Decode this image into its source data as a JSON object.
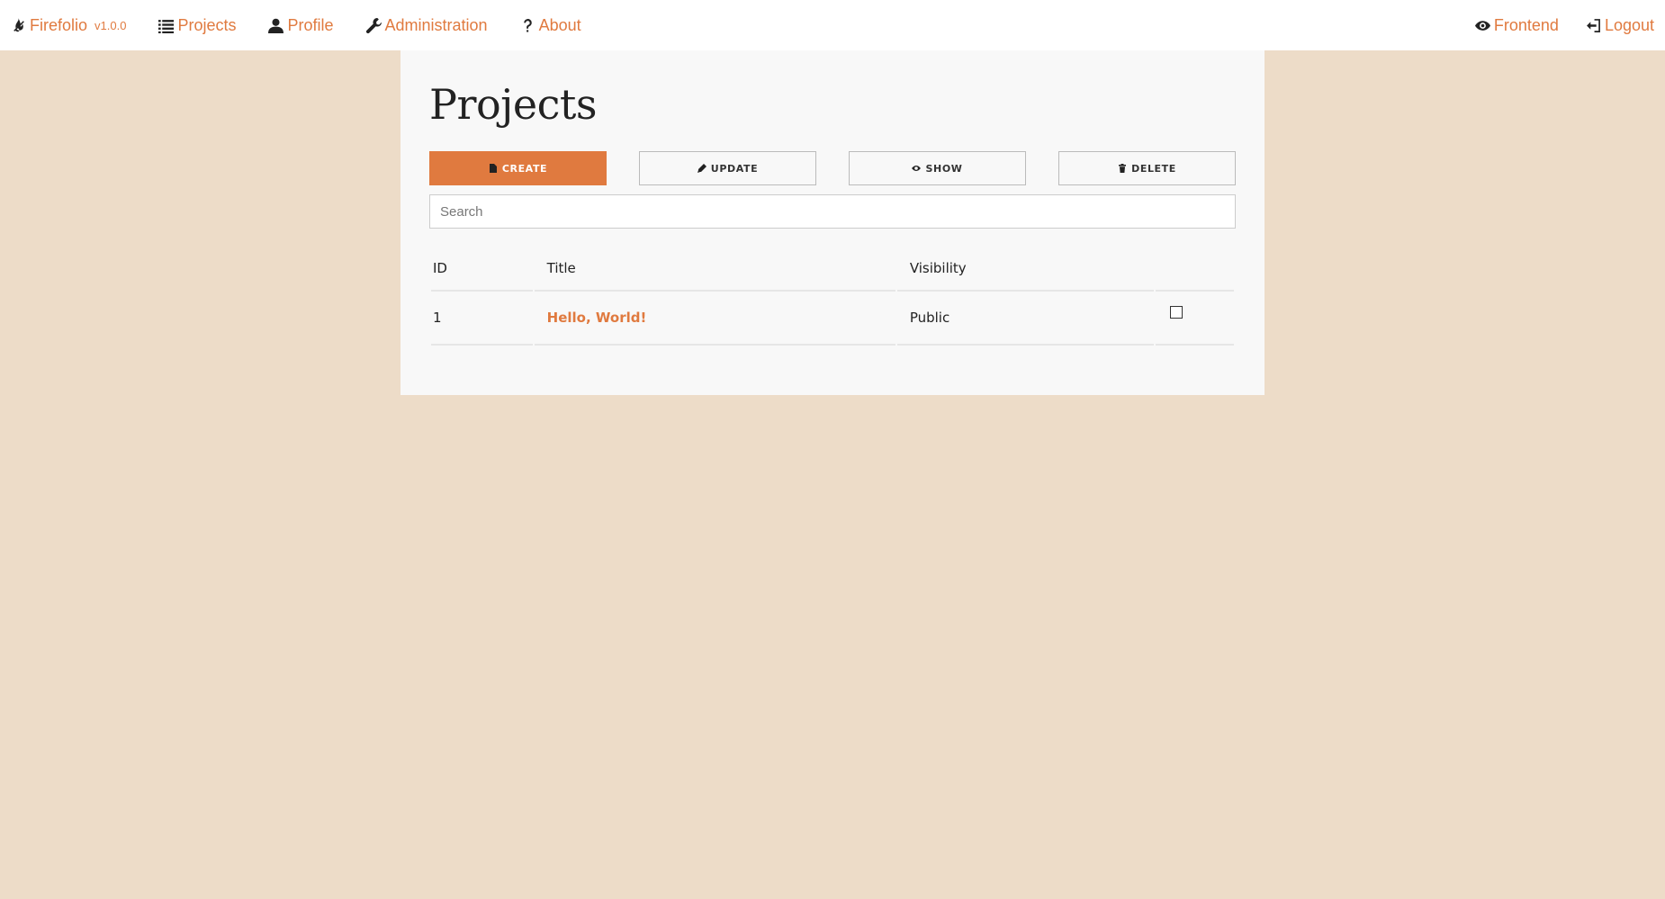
{
  "nav": {
    "brand": "Firefolio",
    "version": "v1.0.0",
    "left_items": [
      {
        "label": "Projects",
        "icon": "list-icon"
      },
      {
        "label": "Profile",
        "icon": "user-icon"
      },
      {
        "label": "Administration",
        "icon": "wrench-icon"
      },
      {
        "label": "About",
        "icon": "question-icon"
      }
    ],
    "right_items": [
      {
        "label": "Frontend",
        "icon": "eye-icon"
      },
      {
        "label": "Logout",
        "icon": "logout-icon"
      }
    ]
  },
  "page": {
    "title": "Projects"
  },
  "toolbar": {
    "create_label": "CREATE",
    "update_label": "UPDATE",
    "show_label": "SHOW",
    "delete_label": "DELETE"
  },
  "search": {
    "placeholder": "Search",
    "value": ""
  },
  "table": {
    "columns": [
      "ID",
      "Title",
      "Visibility",
      ""
    ],
    "rows": [
      {
        "id": "1",
        "title": "Hello, World!",
        "visibility": "Public",
        "selected": false
      }
    ]
  },
  "colors": {
    "accent": "#e07a3f",
    "background": "#eddcc8",
    "card": "#f8f8f8"
  }
}
